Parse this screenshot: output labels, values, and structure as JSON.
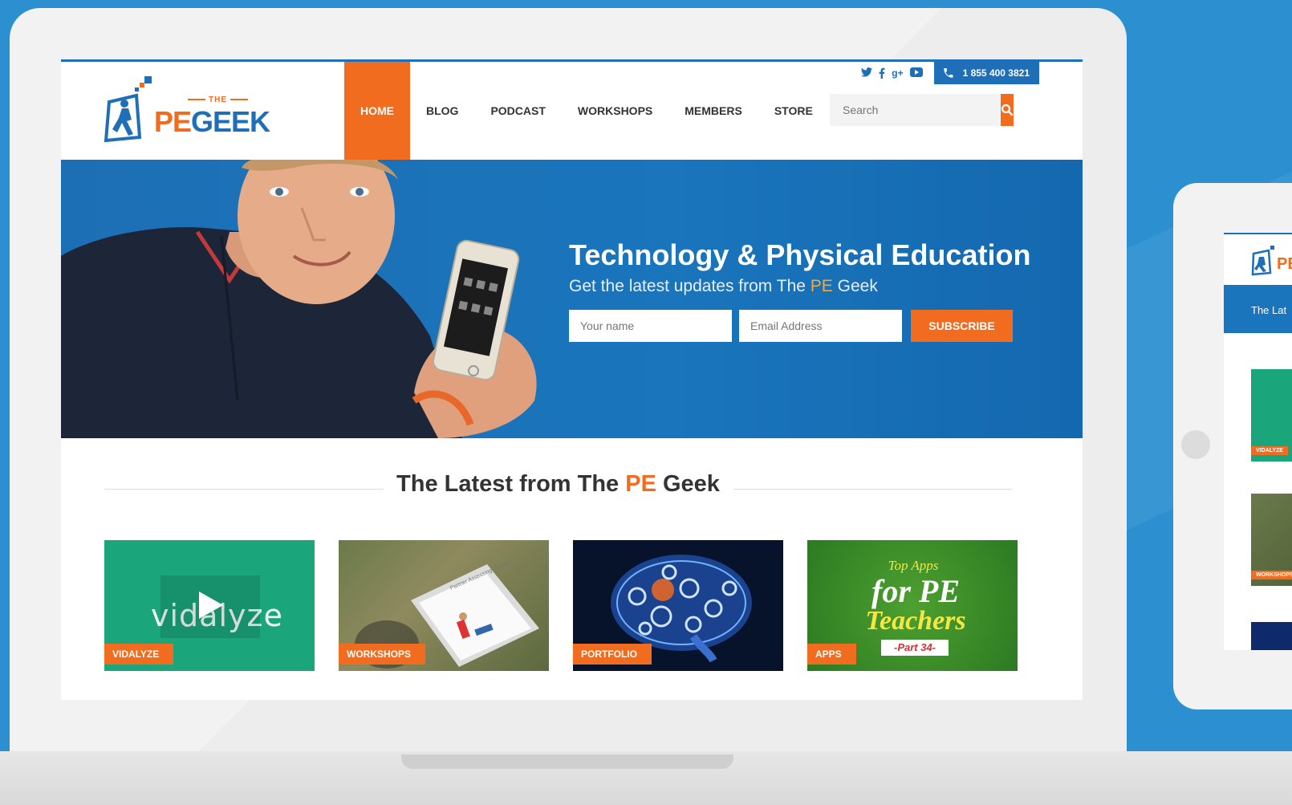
{
  "header": {
    "logo": {
      "the": "THE",
      "pe": "PE",
      "geek": "GEEK"
    },
    "phone": "1 855 400 3821",
    "social_icons": [
      "twitter-icon",
      "facebook-icon",
      "google-plus-icon",
      "youtube-icon"
    ]
  },
  "nav": {
    "items": [
      {
        "label": "HOME",
        "active": true
      },
      {
        "label": "BLOG"
      },
      {
        "label": "PODCAST"
      },
      {
        "label": "WORKSHOPS"
      },
      {
        "label": "MEMBERS"
      },
      {
        "label": "STORE"
      }
    ]
  },
  "search": {
    "placeholder": "Search"
  },
  "hero": {
    "title": "Technology & Physical Education",
    "subtitle_pre": "Get the latest updates from The ",
    "subtitle_pe": "PE",
    "subtitle_post": " Geek",
    "name_placeholder": "Your name",
    "email_placeholder": "Email Address",
    "subscribe_label": "SUBSCRIBE"
  },
  "latest": {
    "title_pre": "The Latest from The ",
    "title_pe": "PE",
    "title_post": " Geek"
  },
  "cards": [
    {
      "tag": "VIDALYZE",
      "image_text": "vidalyze"
    },
    {
      "tag": "WORKSHOPS",
      "image_text": "Partner Assessing Games"
    },
    {
      "tag": "PORTFOLIO"
    },
    {
      "tag": "APPS",
      "image_text": [
        "Top Apps",
        "for PE",
        "Teachers",
        "-Part 34-"
      ]
    }
  ],
  "tablet": {
    "band_text": "The Lat",
    "logo_text": "PE",
    "cards": [
      {
        "tag": "VIDALYZE"
      },
      {
        "tag": "WORKSHOPS"
      }
    ]
  },
  "colors": {
    "brand_blue": "#1f6fb8",
    "brand_orange": "#f26c1f",
    "background": "#2c8fd0"
  }
}
